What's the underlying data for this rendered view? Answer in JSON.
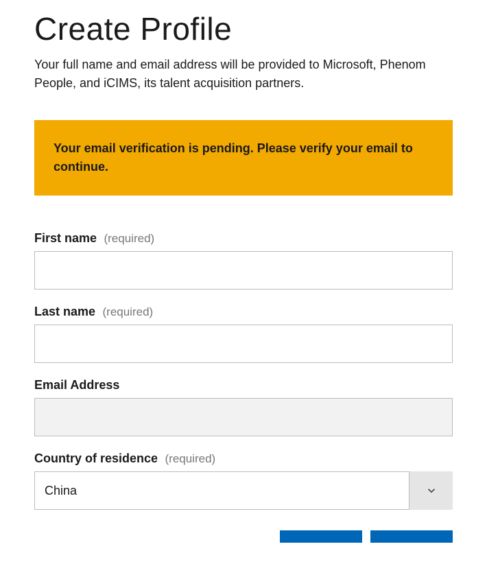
{
  "header": {
    "title": "Create Profile",
    "subtitle": "Your full name and email address will be provided to Microsoft, Phenom People, and iCIMS, its talent acquisition partners."
  },
  "alert": {
    "message": "Your email verification is pending. Please verify your email to continue."
  },
  "form": {
    "first_name": {
      "label": "First name",
      "required_text": "(required)",
      "value": ""
    },
    "last_name": {
      "label": "Last name",
      "required_text": "(required)",
      "value": ""
    },
    "email": {
      "label": "Email Address",
      "value": ""
    },
    "country": {
      "label": "Country of residence",
      "required_text": "(required)",
      "selected": "China"
    }
  }
}
